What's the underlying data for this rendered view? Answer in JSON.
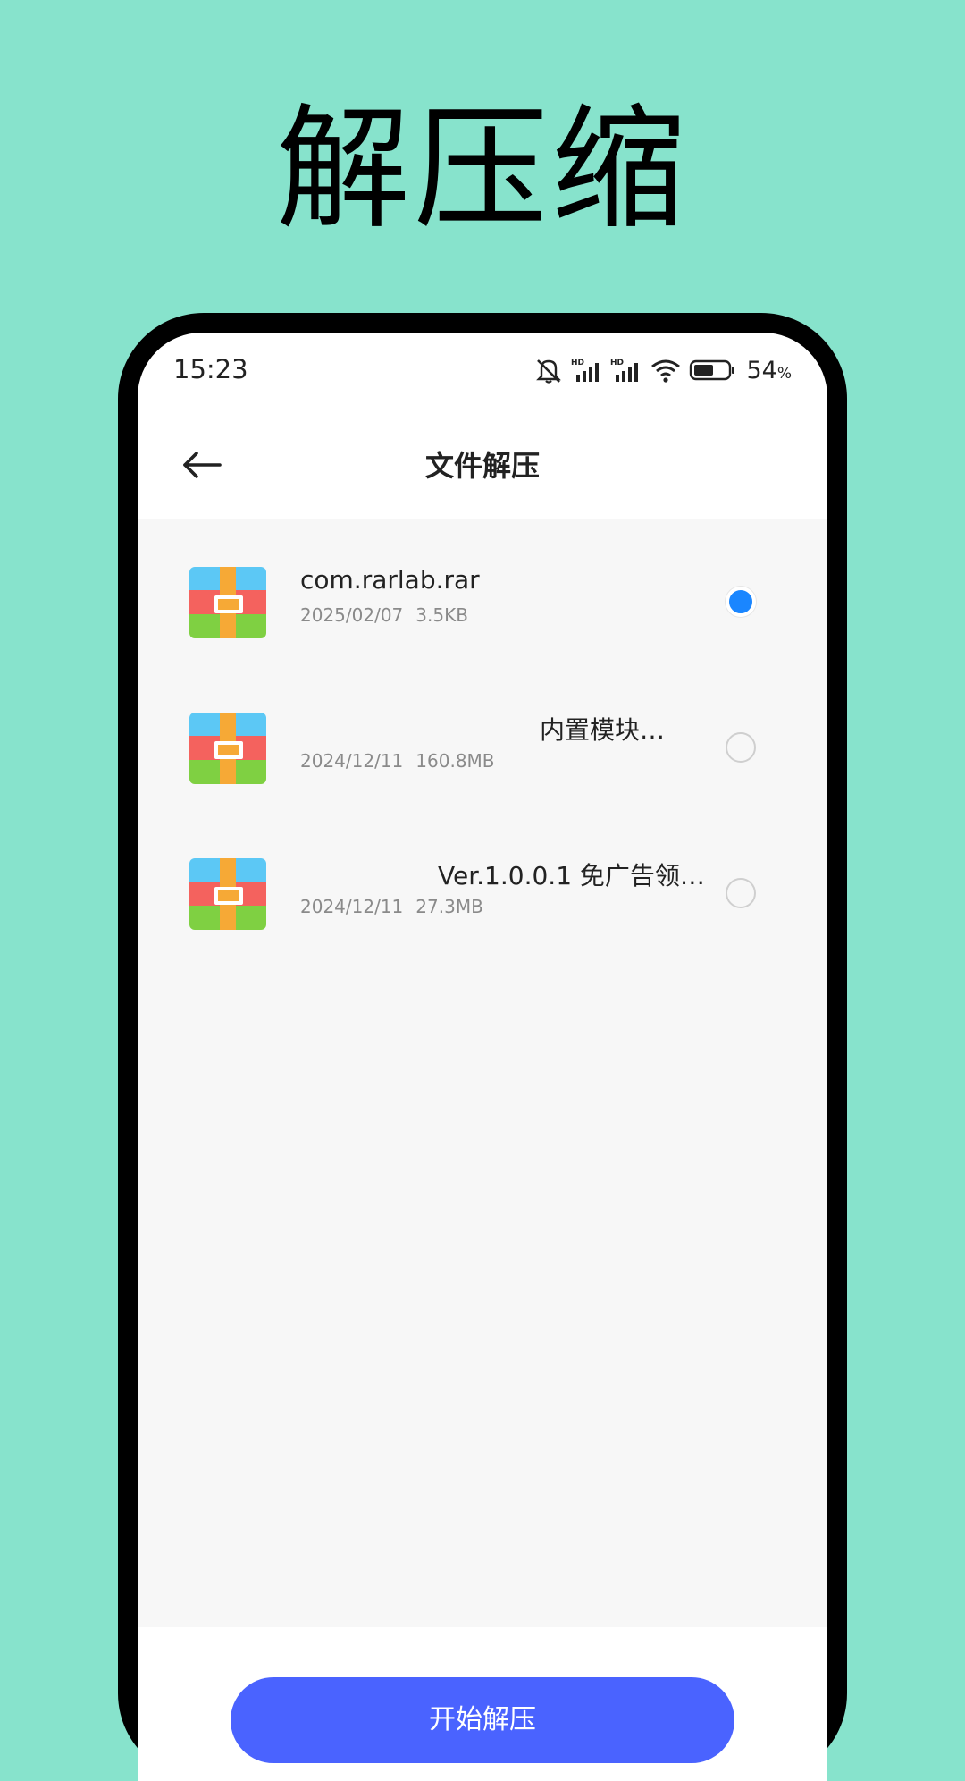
{
  "promo": {
    "title": "解压缩"
  },
  "status_bar": {
    "time": "15:23",
    "battery_level": "54",
    "battery_unit": "%",
    "icons": [
      "mute-icon",
      "hd-signal-icon",
      "hd-signal-icon",
      "wifi-icon",
      "battery-icon"
    ]
  },
  "header": {
    "back_icon": "arrow-left-icon",
    "title": "文件解压"
  },
  "files": [
    {
      "name": "com.rarlab.rar",
      "date": "2025/02/07",
      "size": "3.5KB",
      "selected": true
    },
    {
      "name": "内置模块…",
      "date": "2024/12/11",
      "size": "160.8MB",
      "selected": false
    },
    {
      "name": "Ver.1.0.0.1 免广告领…",
      "date": "2024/12/11",
      "size": "27.3MB",
      "selected": false
    }
  ],
  "actions": {
    "start_label": "开始解压"
  },
  "colors": {
    "background": "#87e3cc",
    "accent": "#4a63ff",
    "radio_selected": "#1a86ff",
    "list_background": "#f7f7f7"
  }
}
